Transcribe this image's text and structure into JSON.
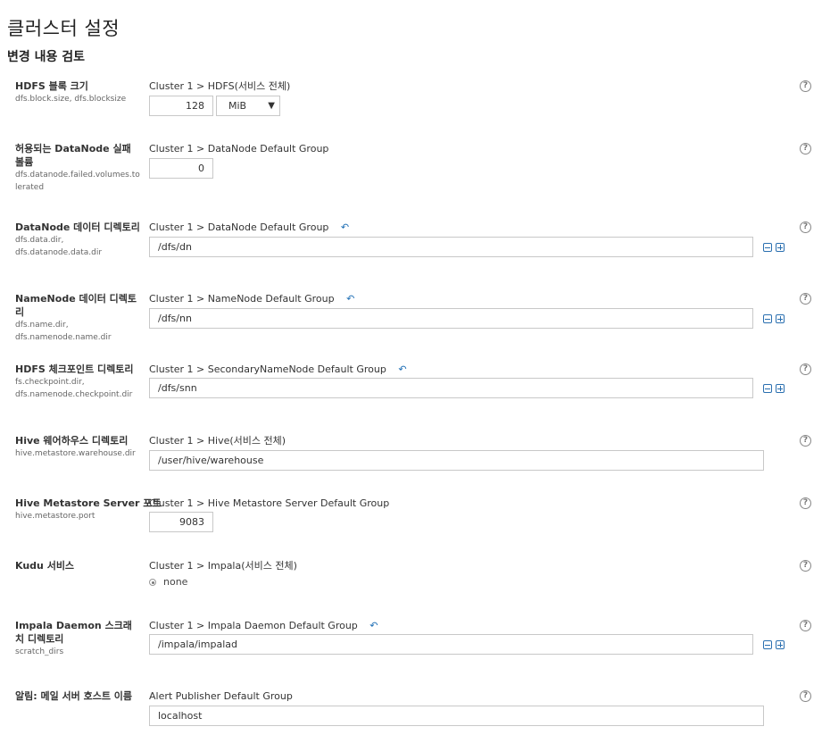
{
  "page": {
    "title": "클러스터 설정",
    "section": "변경 내용 검토"
  },
  "settings": [
    {
      "label": "HDFS 블록 크기",
      "keys": [
        "dfs.block.size, dfs.blocksize"
      ],
      "scope": "Cluster 1 > HDFS(서비스 전체)",
      "value": "128",
      "unit": "MiB"
    },
    {
      "label": "허용되는 DataNode 실패 볼륨",
      "keys": [
        "dfs.datanode.failed.volumes.tolerated"
      ],
      "scope": "Cluster 1 > DataNode Default Group",
      "value": "0"
    },
    {
      "label": "DataNode 데이터 디렉토리",
      "keys": [
        "dfs.data.dir,",
        "dfs.datanode.data.dir"
      ],
      "scope": "Cluster 1 > DataNode Default Group",
      "value": "/dfs/dn"
    },
    {
      "label": "NameNode 데이터 디렉토리",
      "keys": [
        "dfs.name.dir,",
        "dfs.namenode.name.dir"
      ],
      "scope": "Cluster 1 > NameNode Default Group",
      "value": "/dfs/nn"
    },
    {
      "label": "HDFS 체크포인트 디렉토리",
      "keys": [
        "fs.checkpoint.dir,",
        "dfs.namenode.checkpoint.dir"
      ],
      "scope": "Cluster 1 > SecondaryNameNode Default Group",
      "value": "/dfs/snn"
    },
    {
      "label": "Hive 웨어하우스 디렉토리",
      "keys": [
        "hive.metastore.warehouse.dir"
      ],
      "scope": "Cluster 1 > Hive(서비스 전체)",
      "value": "/user/hive/warehouse"
    },
    {
      "label": "Hive Metastore Server 포트",
      "keys": [
        "hive.metastore.port"
      ],
      "scope": "Cluster 1 > Hive Metastore Server Default Group",
      "value": "9083"
    },
    {
      "label": "Kudu 서비스",
      "keys": [],
      "scope": "Cluster 1 > Impala(서비스 전체)",
      "value": "none"
    },
    {
      "label": "Impala Daemon 스크래치 디렉토리",
      "keys": [
        "scratch_dirs"
      ],
      "scope": "Cluster 1 > Impala Daemon Default Group",
      "value": "/impala/impalad"
    },
    {
      "label": "알림: 메일 서버 호스트 이름",
      "keys": [],
      "scope": "Alert Publisher Default Group",
      "value": "localhost"
    }
  ],
  "icons": {
    "undo": "undo-arrow-icon",
    "help": "help-circle-icon",
    "remove": "minus-square-icon",
    "add": "plus-square-icon"
  },
  "help_glyph": "?",
  "undo_glyph": "↶",
  "select_arrow": "▼"
}
